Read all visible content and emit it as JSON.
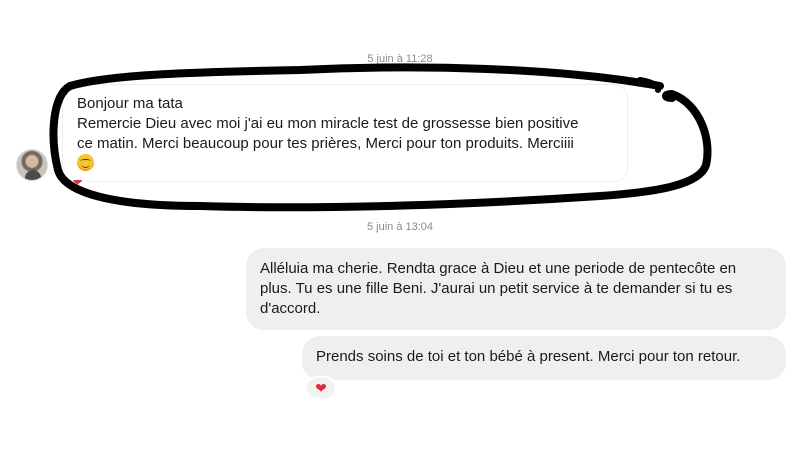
{
  "conversation": {
    "timestamp_1": "5 juin à 11:28",
    "timestamp_2": "5 juin à 13:04",
    "incoming": {
      "line_1": "Bonjour ma tata",
      "line_2": "Remercie Dieu avec moi j'ai eu mon miracle test de grossesse bien positive",
      "line_3": "ce matin. Merci beaucoup pour tes prières, Merci pour ton produits. Merciiii",
      "emoji": "smiling-face-emoji",
      "reaction": "heart"
    },
    "outgoing_1": {
      "line_1": "Alléluia ma cherie. Rendta grace à Dieu et une periode de pentecôte en",
      "line_2": "plus. Tu es une fille Beni. J'aurai un petit service à te demander si tu es",
      "line_3": "d'accord."
    },
    "outgoing_2": {
      "text": "Prends soins de toi et ton bébé à present. Merci pour ton retour.",
      "reaction": "heart"
    }
  },
  "colors": {
    "incoming_bubble": "#ffffff",
    "outgoing_bubble": "#efefef",
    "heart": "#e02d3c",
    "scribble": "#000000"
  },
  "icons": {
    "heart_glyph": "❤"
  }
}
